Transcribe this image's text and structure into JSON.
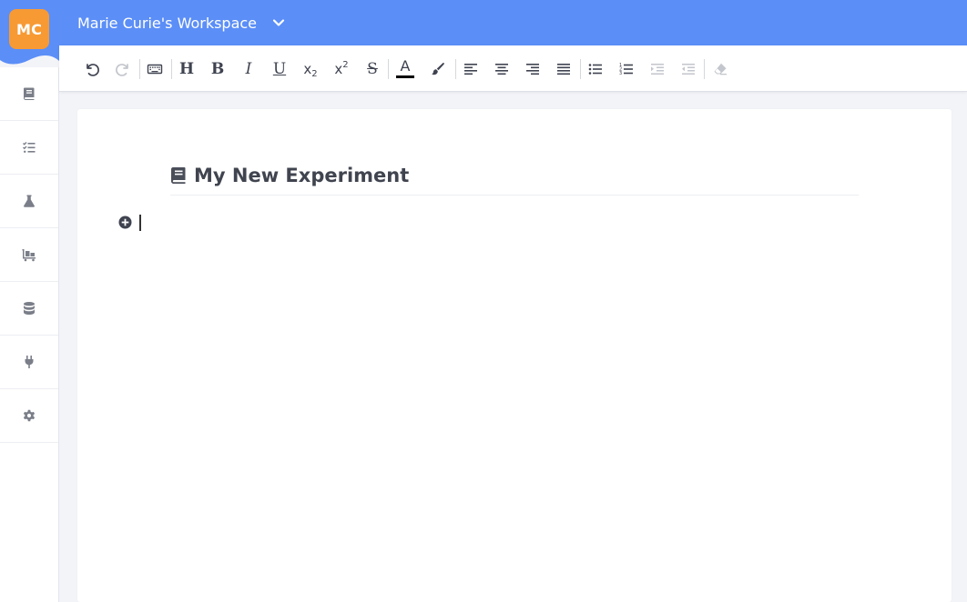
{
  "header": {
    "avatar_initials": "MC",
    "workspace_name": "Marie Curie's Workspace",
    "brand_color": "#5b8ef7",
    "avatar_color": "#f79a34"
  },
  "sidebar": {
    "items": [
      {
        "icon": "notebook-icon"
      },
      {
        "icon": "task-list-icon"
      },
      {
        "icon": "flask-icon"
      },
      {
        "icon": "inventory-cart-icon"
      },
      {
        "icon": "database-icon"
      },
      {
        "icon": "plug-icon"
      },
      {
        "icon": "gear-icon"
      }
    ]
  },
  "toolbar": {
    "heading_label": "H",
    "bold_label": "B",
    "italic_label": "I",
    "underline_label": "U",
    "subscript_label": "x",
    "subscript_sub": "2",
    "superscript_label": "x",
    "superscript_sup": "2",
    "strike_label": "S",
    "font_color_label": "A",
    "font_color_value": "#000000"
  },
  "document": {
    "title": "My New Experiment",
    "body": ""
  }
}
